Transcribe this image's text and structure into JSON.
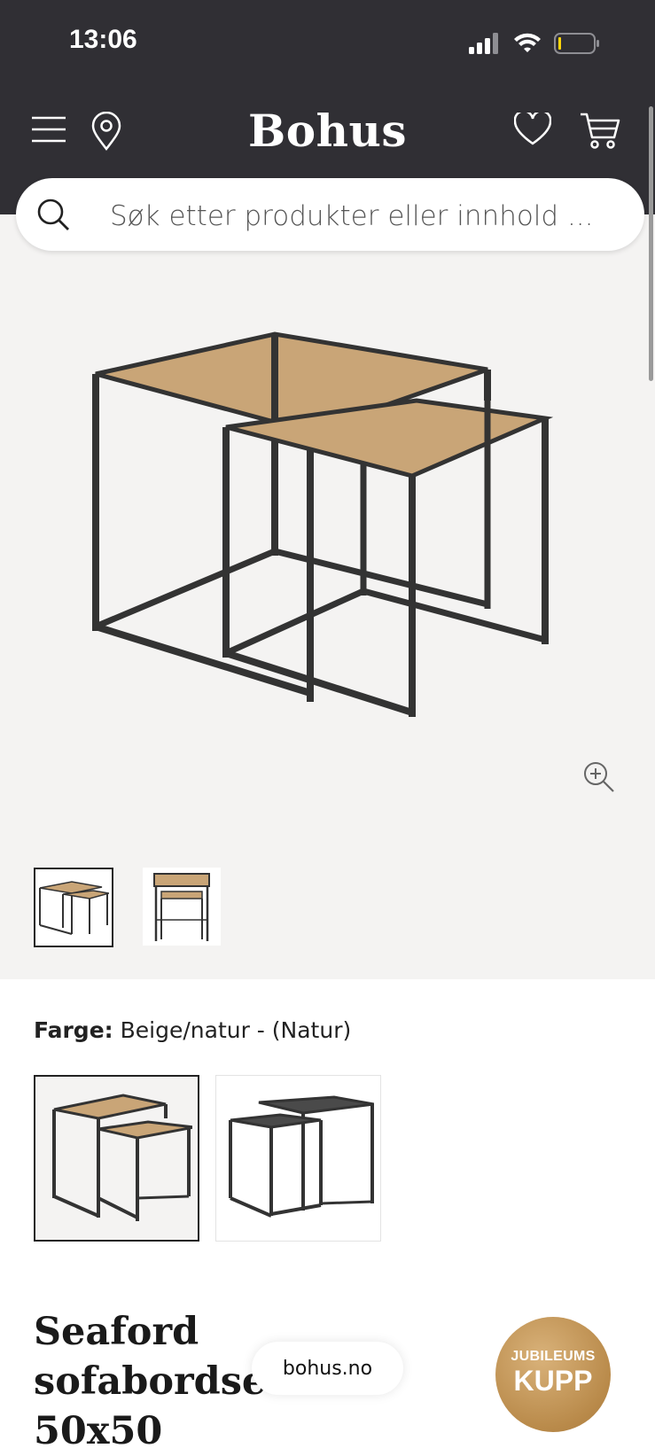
{
  "status_bar": {
    "time": "13:06"
  },
  "header": {
    "brand": "Bohus"
  },
  "search": {
    "placeholder": "Søk etter produkter eller innhold ..."
  },
  "product": {
    "color_label": "Farge:",
    "color_value": "Beige/natur - (Natur)",
    "title_line1": "Seaford sofabordsett",
    "title_line2": "50x50"
  },
  "badge": {
    "line1": "JUBILEUMS",
    "line2": "KUPP"
  },
  "browser": {
    "url": "bohus.no"
  },
  "colors": {
    "header_bg": "#302f34",
    "gallery_bg": "#f4f3f2",
    "badge_gold": "#c49a5c"
  },
  "icons": [
    "menu-icon",
    "location-pin-icon",
    "heart-icon",
    "cart-icon",
    "search-icon",
    "zoom-in-icon"
  ]
}
